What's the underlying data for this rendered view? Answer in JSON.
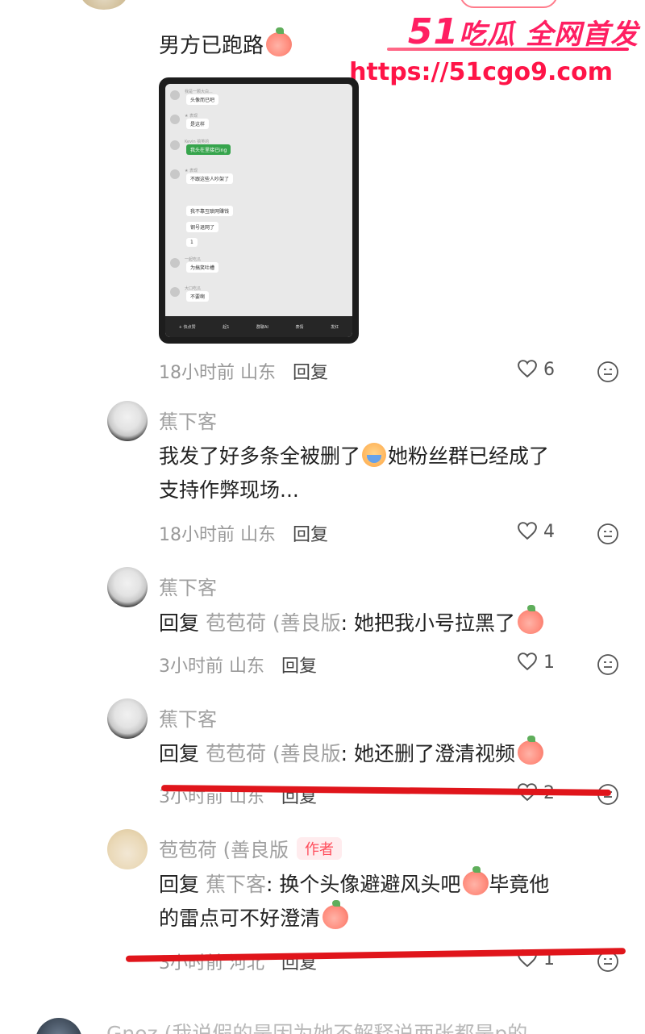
{
  "watermark": {
    "brand_num": "51",
    "brand_text": "吃瓜 全网首发",
    "url": "https://51cgo9.com"
  },
  "post": {
    "title": "男方已跑路",
    "meta_time": "18小时前",
    "meta_location": "山东",
    "reply_label": "回复",
    "likes": "6"
  },
  "chat_preview": {
    "rows": [
      {
        "name": "我是一颗大白...",
        "text": "头像而已吧",
        "green": false
      },
      {
        "name": "★ 表现",
        "text": "是这样",
        "green": false
      },
      {
        "name": "Kevin 搞笑的",
        "text": "我头在里接已ing",
        "green": true
      },
      {
        "name": "★ 表现",
        "text": "不跟这些人吵架了",
        "green": false
      },
      {
        "name": "",
        "text": "我不靠互联网赚钱",
        "green": false
      },
      {
        "name": "",
        "text": "钢号退网了",
        "green": false
      },
      {
        "name": "",
        "text": "1",
        "green": false
      },
      {
        "name": "一起吃瓜",
        "text": "为搞笑吐槽",
        "green": false
      },
      {
        "name": "大口吃瓜",
        "text": "不要啊",
        "green": false
      }
    ],
    "footer": [
      "+ 快点赞",
      "起1",
      "群聊AI",
      "表情",
      "发红"
    ]
  },
  "comments": [
    {
      "name": "蕉下客",
      "text_line1": "我发了好多条全被删了",
      "text_line1b": "她粉丝群已经成了",
      "text_line2": "支持作弊现场...",
      "time": "18小时前",
      "location": "山东",
      "reply_label": "回复",
      "likes": "4"
    },
    {
      "name": "蕉下客",
      "reply_prefix": "回复",
      "reply_target": "苞苞荷 (善良版",
      "text": ": 她把我小号拉黑了",
      "time": "3小时前",
      "location": "山东",
      "reply_label": "回复",
      "likes": "1"
    },
    {
      "name": "蕉下客",
      "reply_prefix": "回复",
      "reply_target": "苞苞荷 (善良版",
      "text": ": 她还删了澄清视频",
      "time": "3小时前",
      "location": "山东",
      "reply_label": "回复",
      "likes": "2"
    },
    {
      "name": "苞苞荷 (善良版",
      "author_tag": "作者",
      "reply_prefix": "回复",
      "reply_target": "蕉下客",
      "text": ": 换个头像避避风头吧",
      "text_b": "毕竟他",
      "text_line2": "的雷点可不好澄清",
      "time": "3小时前",
      "location": "河北",
      "reply_label": "回复",
      "likes": "1"
    }
  ],
  "bottom_comment": {
    "text": "Gnoz (我说假的是因为她不解释说两张都是p的"
  },
  "colors": {
    "strike": "#e0151b",
    "watermark": "#ff1f62",
    "author_tag": "#ff4d5b"
  }
}
